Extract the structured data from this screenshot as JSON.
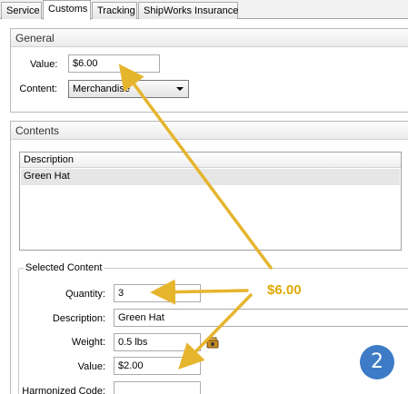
{
  "tabs": [
    {
      "label": "Service"
    },
    {
      "label": "Customs"
    },
    {
      "label": "Tracking"
    },
    {
      "label": "ShipWorks Insurance"
    }
  ],
  "general": {
    "title": "General",
    "value_label": "Value:",
    "value": "$6.00",
    "content_label": "Content:",
    "content_selected": "Merchandise"
  },
  "contents": {
    "title": "Contents",
    "column_header": "Description",
    "rows": [
      {
        "description": "Green Hat"
      }
    ]
  },
  "selected_content": {
    "title": "Selected Content",
    "quantity_label": "Quantity:",
    "quantity": "3",
    "description_label": "Description:",
    "description": "Green Hat",
    "weight_label": "Weight:",
    "weight": "0.5 lbs",
    "value_label": "Value:",
    "value": "$2.00",
    "harmonized_label": "Harmonized Code:",
    "harmonized": ""
  },
  "annotation": {
    "total_label": "$6.00",
    "step_number": "2",
    "arrow_color": "#e6b52e",
    "badge_color": "#3d7bc6"
  }
}
